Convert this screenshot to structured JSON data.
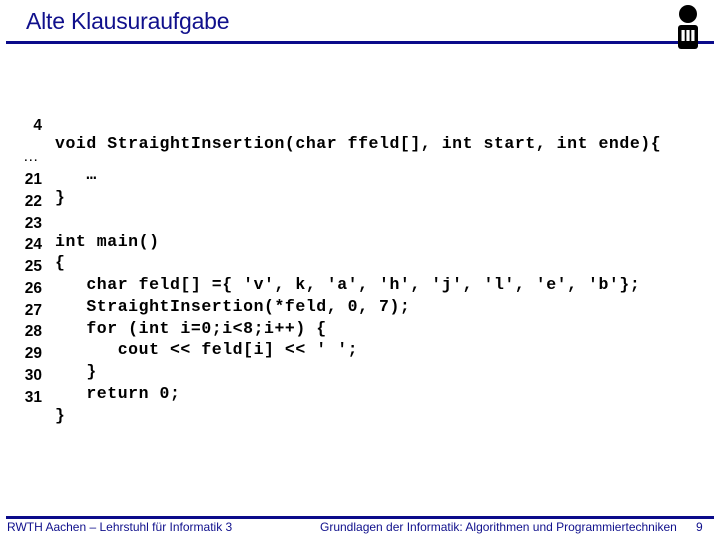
{
  "header": {
    "title": "Alte Klausuraufgabe",
    "logo": "rwth-informatik-logo-icon",
    "accent_color": "#10108c"
  },
  "code": {
    "lines": [
      {
        "number": "4",
        "text": "void StraightInsertion(char ffeld[], int start, int ende){"
      },
      {
        "number": "…",
        "text": "   …"
      },
      {
        "number": "21",
        "text": "}"
      },
      {
        "number": "22",
        "text": ""
      },
      {
        "number": "23",
        "text": "int main()"
      },
      {
        "number": "24",
        "text": "{"
      },
      {
        "number": "25",
        "text": "   char feld[] ={ 'v', k, 'a', 'h', 'j', 'l', 'e', 'b'};"
      },
      {
        "number": "26",
        "text": "   StraightInsertion(*feld, 0, 7);"
      },
      {
        "number": "27",
        "text": "   for (int i=0;i<8;i++) {"
      },
      {
        "number": "28",
        "text": "      cout << feld[i] << ' ';"
      },
      {
        "number": "29",
        "text": "   }"
      },
      {
        "number": "30",
        "text": "   return 0;"
      },
      {
        "number": "31",
        "text": "}"
      }
    ]
  },
  "footer": {
    "left": "RWTH Aachen – Lehrstuhl für Informatik 3",
    "center": "Grundlagen der Informatik: Algorithmen und Programmiertechniken",
    "page_number": "9"
  }
}
